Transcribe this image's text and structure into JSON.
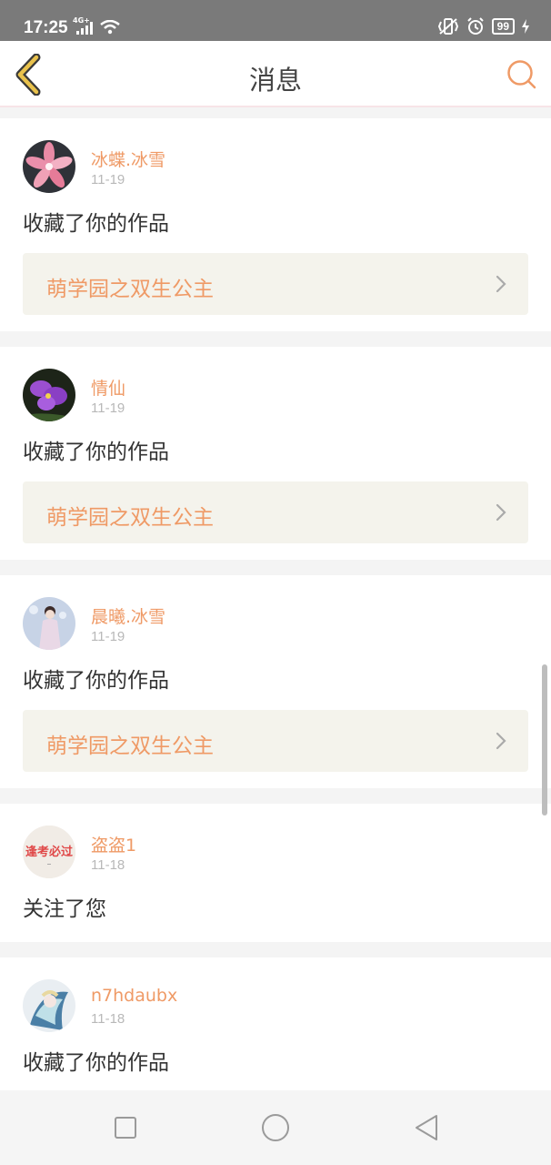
{
  "status_bar": {
    "time": "17:25",
    "network": "4G+",
    "battery": "99"
  },
  "header": {
    "title": "消息"
  },
  "colors": {
    "accent": "#ef9a66",
    "back_icon": "#e9c24c",
    "card_link_bg": "#f4f3ec"
  },
  "icons": {
    "back": "chevron-left-icon",
    "search": "search-icon",
    "item_arrow": "chevron-right-icon",
    "nav_recent": "square-icon",
    "nav_home": "circle-icon",
    "nav_back": "triangle-left-icon"
  },
  "messages": [
    {
      "username": "冰蝶.冰雪",
      "date": "11-19",
      "action": "收藏了你的作品",
      "work": "萌学园之双生公主"
    },
    {
      "username": "情仙",
      "date": "11-19",
      "action": "收藏了你的作品",
      "work": "萌学园之双生公主"
    },
    {
      "username": "晨曦.冰雪",
      "date": "11-19",
      "action": "收藏了你的作品",
      "work": "萌学园之双生公主"
    },
    {
      "username": "盗盗1",
      "date": "11-18",
      "action": "关注了您",
      "avatar_text": "逢考必过"
    },
    {
      "username": "n7hdaubx",
      "date": "11-18",
      "action": "收藏了你的作品",
      "work": ""
    }
  ]
}
